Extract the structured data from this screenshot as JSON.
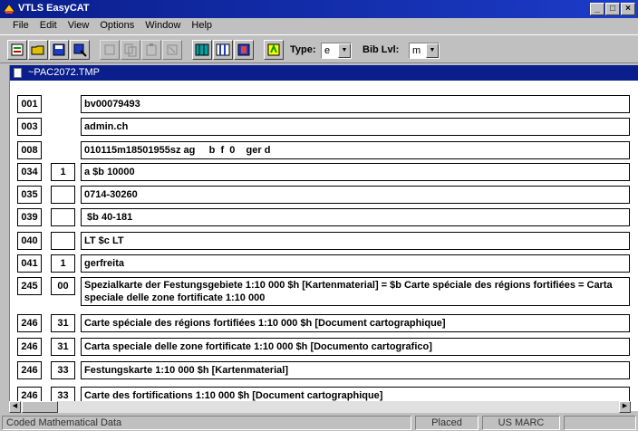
{
  "window": {
    "title": "VTLS EasyCAT",
    "controls": [
      "_",
      "□",
      "×"
    ]
  },
  "menu": [
    "File",
    "Edit",
    "View",
    "Options",
    "Window",
    "Help"
  ],
  "toolbar": {
    "type_label": "Type:",
    "type_value": "e",
    "bib_label": "Bib Lvl:",
    "bib_value": "m"
  },
  "document": {
    "title": "~PAC2072.TMP",
    "fields": [
      {
        "tag": "001",
        "ind": "",
        "data": "bv00079493"
      },
      {
        "tag": "003",
        "ind": "",
        "data": "admin.ch"
      },
      {
        "tag": "008",
        "ind": "",
        "data": "010115m18501955sz ag     b  f  0    ger d"
      },
      {
        "tag": "034",
        "ind": "1",
        "data": "a $b 10000"
      },
      {
        "tag": "035",
        "ind": "",
        "data": "0714-30260"
      },
      {
        "tag": "039",
        "ind": "",
        "data": " $b 40-181"
      },
      {
        "tag": "040",
        "ind": "",
        "data": "LT $c LT"
      },
      {
        "tag": "041",
        "ind": "1",
        "data": "gerfreita"
      },
      {
        "tag": "245",
        "ind": "00",
        "data": "Spezialkarte der Festungsgebiete 1:10 000 $h [Kartenmaterial] = $b Carte spéciale des régions fortifiées = Carta speciale delle zone fortificate 1:10 000"
      },
      {
        "tag": "246",
        "ind": "31",
        "data": "Carte spéciale des régions fortifiées 1:10 000 $h [Document cartographique]"
      },
      {
        "tag": "246",
        "ind": "31",
        "data": "Carta speciale delle zone fortificate 1:10 000 $h [Documento cartografico]"
      },
      {
        "tag": "246",
        "ind": "33",
        "data": "Festungskarte 1:10 000 $h [Kartenmaterial]"
      },
      {
        "tag": "246",
        "ind": "33",
        "data": "Carte des fortifications 1:10 000 $h [Document cartographique]"
      }
    ]
  },
  "status": {
    "field_desc": "Coded Mathematical Data",
    "mode": "Placed",
    "format": "US MARC"
  }
}
